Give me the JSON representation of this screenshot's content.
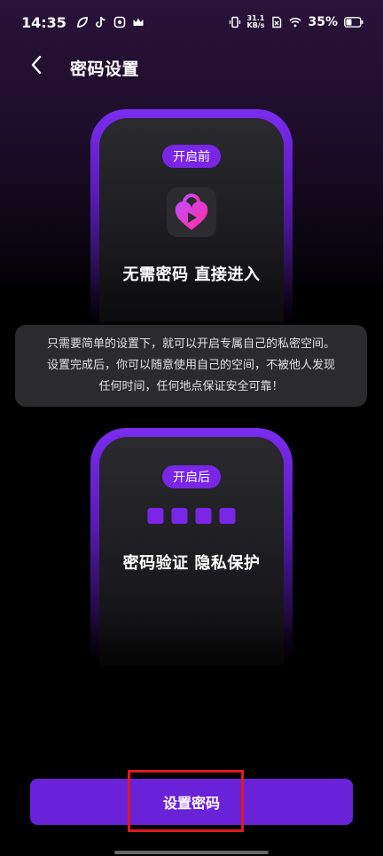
{
  "status_bar": {
    "time": "14:35",
    "left_icons": [
      "leaf-icon",
      "tiktok-icon",
      "app-icon",
      "crown-icon"
    ],
    "net_speed_value": "31.1",
    "net_speed_unit": "KB/s",
    "battery": "35%"
  },
  "header": {
    "title": "密码设置"
  },
  "before_card": {
    "badge": "开启前",
    "caption": "无需密码 直接进入"
  },
  "info": {
    "line1": "只需要简单的设置下，就可以开启专属自己的私密空间。",
    "line2": "设置完成后，你可以随意使用自己的空间，不被他人发现",
    "line3": "任何时间，任何地点保证安全可靠！"
  },
  "after_card": {
    "badge": "开启后",
    "caption": "密码验证 隐私保护",
    "pin_dots": 4
  },
  "action": {
    "button_label": "设置密码"
  },
  "colors": {
    "accent": "#7a26e6",
    "button": "#6a22d8",
    "highlight": "#e0191c"
  }
}
